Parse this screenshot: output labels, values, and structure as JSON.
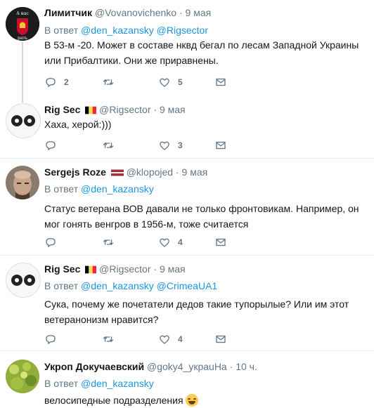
{
  "tweets": [
    {
      "name": "Лимитчик",
      "handle": "@Vovanovichenko",
      "time": "9 мая",
      "reply_prefix": "В ответ",
      "reply_to": [
        "@den_kazansky",
        "@Rigsector"
      ],
      "text": "В 53-м -20. Может в составе нквд бегал по лесам Западной Украины или Прибалтики. Они же приравнены.",
      "replies": "2",
      "retweets": "",
      "likes": "5",
      "avatar_text_1": "А нас",
      "avatar_text_2": "рать"
    },
    {
      "name": "Rig Sec",
      "handle": "@Rigsector",
      "time": "9 мая",
      "text": "Хаха, херой:)))",
      "replies": "",
      "retweets": "",
      "likes": "3"
    },
    {
      "name": "Sergejs Roze",
      "handle": "@klopojed",
      "time": "9 мая",
      "reply_prefix": "В ответ",
      "reply_to": [
        "@den_kazansky"
      ],
      "text": "Статус ветерана ВОВ давали не только фронтовикам. Например, он мог гонять венгров в 1956-м, тоже считается",
      "replies": "",
      "retweets": "",
      "likes": "4"
    },
    {
      "name": "Rig Sec",
      "handle": "@Rigsector",
      "time": "9 мая",
      "reply_prefix": "В ответ",
      "reply_to": [
        "@den_kazansky",
        "@CrimeaUA1"
      ],
      "text": "Сука, почему же почетатели дедов такие тупорылые?  Или им этот ветеранонизм нравится?",
      "replies": "",
      "retweets": "",
      "likes": "4"
    },
    {
      "name": "Укроп Докучаевский",
      "handle": "@goky4_украuHa",
      "time": "10 ч.",
      "reply_prefix": "В ответ",
      "reply_to": [
        "@den_kazansky"
      ],
      "text": "велосипедные подразделения"
    }
  ],
  "colors": {
    "link": "#1b95e0",
    "muted": "#657786",
    "separator": "#e6ecf0"
  }
}
